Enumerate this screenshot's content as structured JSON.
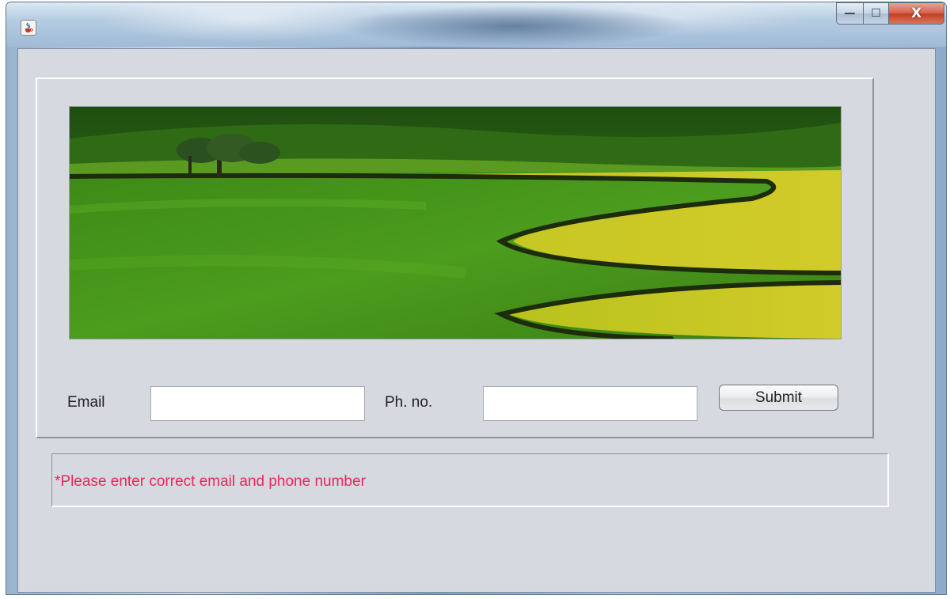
{
  "window": {
    "title": "",
    "controls": {
      "minimize_glyph": "—",
      "maximize_glyph": "☐",
      "close_glyph": "X"
    },
    "app_icon": "java-cup-icon"
  },
  "banner": {
    "image": "green-rolling-hills-landscape",
    "colors": {
      "dark_green": "#2f6a14",
      "grass_green": "#4f9a20",
      "yellow_field": "#c9c921"
    }
  },
  "form": {
    "email_label": "Email",
    "email_value": "",
    "phone_label": "Ph. no.",
    "phone_value": "",
    "submit_label": "Submit"
  },
  "message": {
    "text": "*Please enter correct email and phone number",
    "color": "#e8285a"
  }
}
